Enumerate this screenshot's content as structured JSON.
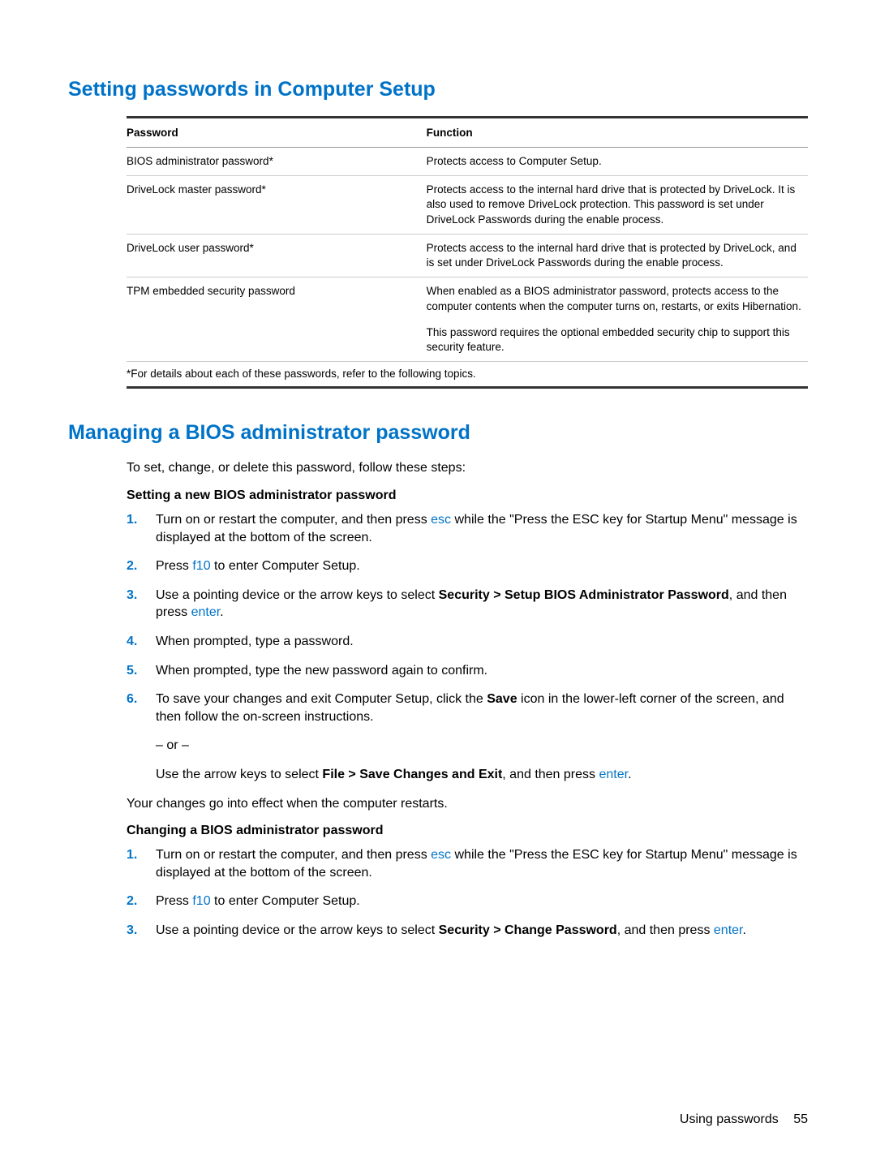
{
  "section1": {
    "title": "Setting passwords in Computer Setup",
    "th_pw": "Password",
    "th_fn": "Function",
    "rows": [
      {
        "pw": "BIOS administrator password*",
        "fn": [
          "Protects access to Computer Setup."
        ]
      },
      {
        "pw": "DriveLock master password*",
        "fn": [
          "Protects access to the internal hard drive that is protected by DriveLock. It is also used to remove DriveLock protection. This password is set under DriveLock Passwords during the enable process."
        ]
      },
      {
        "pw": "DriveLock user password*",
        "fn": [
          "Protects access to the internal hard drive that is protected by DriveLock, and is set under DriveLock Passwords during the enable process."
        ]
      },
      {
        "pw": "TPM embedded security password",
        "fn": [
          "When enabled as a BIOS administrator password, protects access to the computer contents when the computer turns on, restarts, or exits Hibernation.",
          "This password requires the optional embedded security chip to support this security feature."
        ]
      }
    ],
    "footnote": "*For details about each of these passwords, refer to the following topics."
  },
  "section2": {
    "title": "Managing a BIOS administrator password",
    "intro": "To set, change, or delete this password, follow these steps:",
    "sub1": {
      "title": "Setting a new BIOS administrator password",
      "items": [
        {
          "n": "1.",
          "paras": [
            {
              "segs": [
                {
                  "t": "Turn on or restart the computer, and then press "
                },
                {
                  "t": "esc",
                  "cls": "key"
                },
                {
                  "t": " while the \"Press the ESC key for Startup Menu\" message is displayed at the bottom of the screen."
                }
              ]
            }
          ]
        },
        {
          "n": "2.",
          "paras": [
            {
              "segs": [
                {
                  "t": "Press "
                },
                {
                  "t": "f10",
                  "cls": "key"
                },
                {
                  "t": " to enter Computer Setup."
                }
              ]
            }
          ]
        },
        {
          "n": "3.",
          "paras": [
            {
              "segs": [
                {
                  "t": "Use a pointing device or the arrow keys to select "
                },
                {
                  "t": "Security > Setup BIOS Administrator Password",
                  "cls": "bold"
                },
                {
                  "t": ", and then press "
                },
                {
                  "t": "enter",
                  "cls": "key"
                },
                {
                  "t": "."
                }
              ]
            }
          ]
        },
        {
          "n": "4.",
          "paras": [
            {
              "segs": [
                {
                  "t": "When prompted, type a password."
                }
              ]
            }
          ]
        },
        {
          "n": "5.",
          "paras": [
            {
              "segs": [
                {
                  "t": "When prompted, type the new password again to confirm."
                }
              ]
            }
          ]
        },
        {
          "n": "6.",
          "paras": [
            {
              "segs": [
                {
                  "t": "To save your changes and exit Computer Setup, click the "
                },
                {
                  "t": "Save",
                  "cls": "bold"
                },
                {
                  "t": " icon in the lower-left corner of the screen, and then follow the on-screen instructions."
                }
              ]
            },
            {
              "segs": [
                {
                  "t": "– or –"
                }
              ]
            },
            {
              "segs": [
                {
                  "t": "Use the arrow keys to select "
                },
                {
                  "t": "File > Save Changes and Exit",
                  "cls": "bold"
                },
                {
                  "t": ", and then press "
                },
                {
                  "t": "enter",
                  "cls": "key"
                },
                {
                  "t": "."
                }
              ]
            }
          ]
        }
      ],
      "after": "Your changes go into effect when the computer restarts."
    },
    "sub2": {
      "title": "Changing a BIOS administrator password",
      "items": [
        {
          "n": "1.",
          "paras": [
            {
              "segs": [
                {
                  "t": "Turn on or restart the computer, and then press "
                },
                {
                  "t": "esc",
                  "cls": "key"
                },
                {
                  "t": " while the \"Press the ESC key for Startup Menu\" message is displayed at the bottom of the screen."
                }
              ]
            }
          ]
        },
        {
          "n": "2.",
          "paras": [
            {
              "segs": [
                {
                  "t": "Press "
                },
                {
                  "t": "f10",
                  "cls": "key"
                },
                {
                  "t": " to enter Computer Setup."
                }
              ]
            }
          ]
        },
        {
          "n": "3.",
          "paras": [
            {
              "segs": [
                {
                  "t": "Use a pointing device or the arrow keys to select "
                },
                {
                  "t": "Security > Change Password",
                  "cls": "bold"
                },
                {
                  "t": ", and then press "
                },
                {
                  "t": "enter",
                  "cls": "key"
                },
                {
                  "t": "."
                }
              ]
            }
          ]
        }
      ]
    }
  },
  "footer": {
    "label": "Using passwords",
    "page": "55"
  }
}
